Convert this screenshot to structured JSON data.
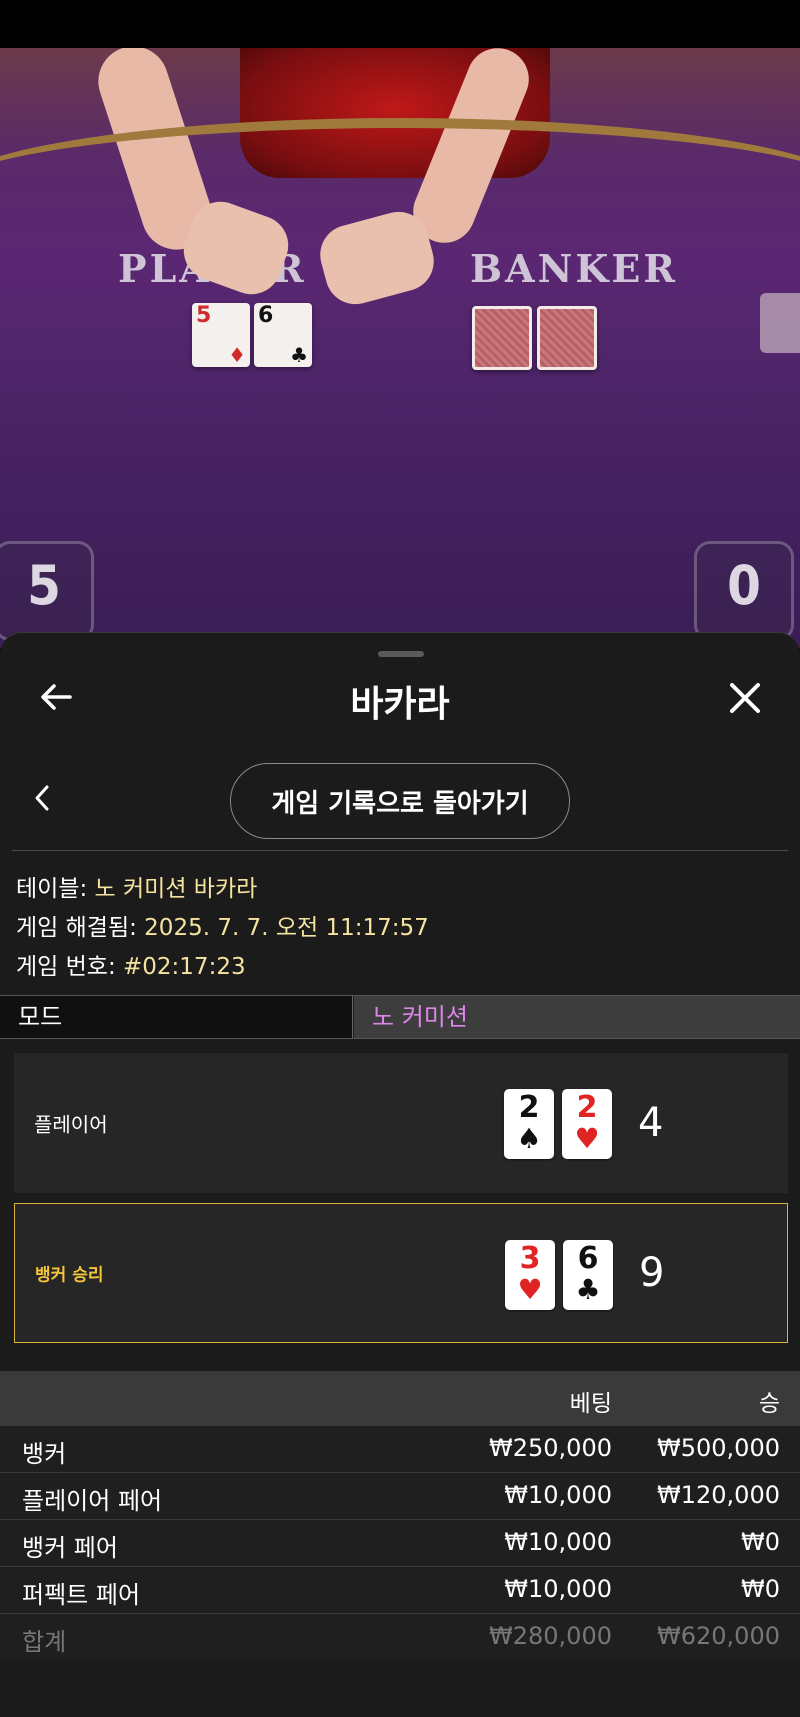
{
  "video": {
    "player_label": "PLAYER",
    "banker_label": "BANKER",
    "player_cards": [
      {
        "rank": "5",
        "suit": "♦",
        "color": "red"
      },
      {
        "rank": "6",
        "suit": "♣",
        "color": "black"
      }
    ],
    "player_score": "5",
    "banker_score": "0"
  },
  "header": {
    "title": "바카라"
  },
  "back_to_history": "게임 기록으로 돌아가기",
  "info": {
    "table_label": "테이블: ",
    "table_value": "노 커미션 바카라",
    "resolved_label": "게임 해결됨: ",
    "resolved_value": "2025. 7. 7. 오전 11:17:57",
    "game_no_label": "게임 번호: ",
    "game_no_value": "#02:17:23"
  },
  "mode": {
    "label": "모드",
    "value": "노 커미션"
  },
  "hands": [
    {
      "name": "플레이어",
      "total": "4",
      "winner": false,
      "cards": [
        {
          "rank": "2",
          "suit": "♠",
          "color": "black"
        },
        {
          "rank": "2",
          "suit": "♥",
          "color": "red"
        }
      ]
    },
    {
      "name": "뱅커 승리",
      "total": "9",
      "winner": true,
      "cards": [
        {
          "rank": "3",
          "suit": "♥",
          "color": "red"
        },
        {
          "rank": "6",
          "suit": "♣",
          "color": "black"
        }
      ]
    }
  ],
  "bets": {
    "col_bet": "베팅",
    "col_win": "승",
    "rows": [
      {
        "label": "뱅커",
        "bet": "₩250,000",
        "win": "₩500,000"
      },
      {
        "label": "플레이어 페어",
        "bet": "₩10,000",
        "win": "₩120,000"
      },
      {
        "label": "뱅커 페어",
        "bet": "₩10,000",
        "win": "₩0"
      },
      {
        "label": "퍼펙트 페어",
        "bet": "₩10,000",
        "win": "₩0"
      }
    ],
    "total": {
      "label": "합계",
      "bet": "₩280,000",
      "win": "₩620,000"
    }
  },
  "colors": {
    "accent_gold": "#d7b53a",
    "mode_value": "#dc87e8",
    "info_value": "#f5e3a0"
  }
}
